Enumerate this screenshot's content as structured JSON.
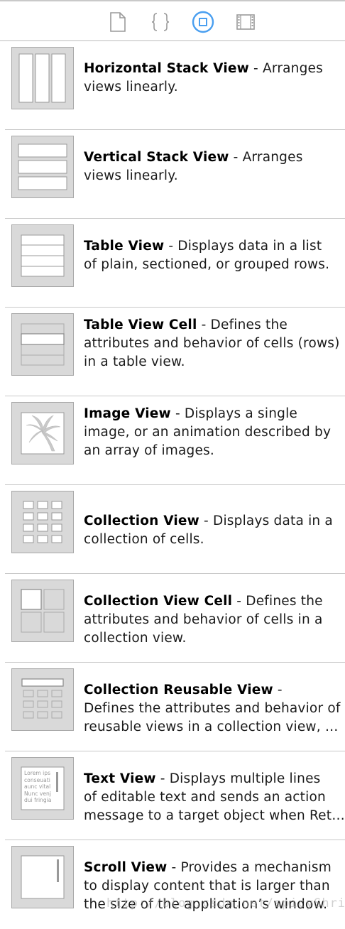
{
  "toolbar": {
    "buttons": [
      {
        "icon": "file-inspector-icon"
      },
      {
        "icon": "code-snippet-library-icon"
      },
      {
        "icon": "object-library-icon",
        "selected": true
      },
      {
        "icon": "media-library-icon"
      }
    ],
    "accent": "#4a9ff0"
  },
  "items": [
    {
      "title": "Horizontal Stack View",
      "line1": " - Arranges",
      "line2": "views linearly.",
      "line3": ""
    },
    {
      "title": "Vertical Stack View",
      "line1": " - Arranges",
      "line2": "views linearly.",
      "line3": ""
    },
    {
      "title": "Table View",
      "line1": " - Displays data in a list",
      "line2": "of plain, sectioned, or grouped rows.",
      "line3": ""
    },
    {
      "title": "Table View Cell",
      "line1": " - Defines the",
      "line2": "attributes and behavior of cells (rows)",
      "line3": "in a table view."
    },
    {
      "title": "Image View",
      "line1": " - Displays a single",
      "line2": "image, or an animation described by",
      "line3": "an array of images."
    },
    {
      "title": "Collection View",
      "line1": " - Displays data in a",
      "line2": "collection of cells.",
      "line3": ""
    },
    {
      "title": "Collection View Cell",
      "line1": " - Defines the",
      "line2": "attributes and behavior of cells in a",
      "line3": "collection view."
    },
    {
      "title": "Collection Reusable View",
      "line1": " -",
      "line2": "Defines the attributes and behavior of",
      "line3": "reusable views in a collection view, s…"
    },
    {
      "title": "Text View",
      "line1": " - Displays multiple lines",
      "line2": "of editable text and sends an action",
      "line3": "message to a target object when Ret…"
    },
    {
      "title": "Scroll View",
      "line1": " - Provides a mechanism",
      "line2": "to display content that is larger than",
      "line3": "the size of the application’s window."
    }
  ],
  "thumb_text": "Lorem ips conseuati aunc vital Nunc venj dui fringia",
  "watermark": "http://blog.csdn.net/spicyShrimp"
}
